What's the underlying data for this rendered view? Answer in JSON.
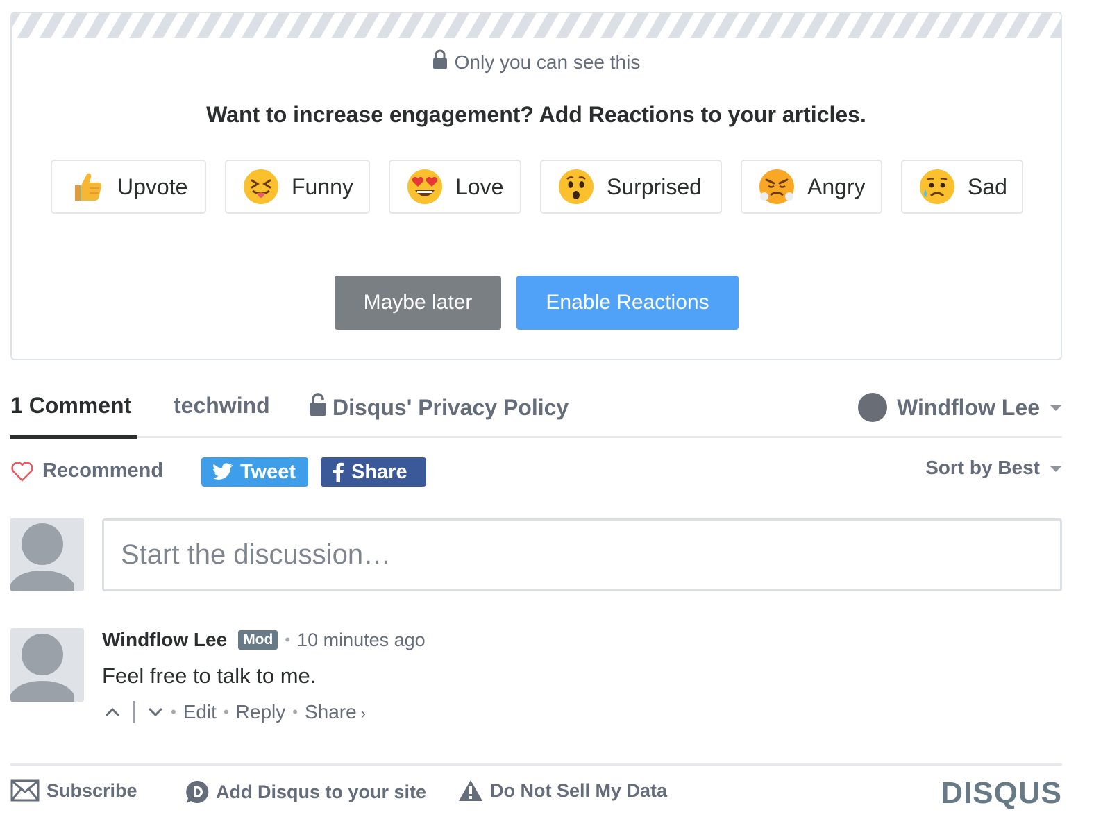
{
  "promo": {
    "private_note": "Only you can see this",
    "title": "Want to increase engagement? Add Reactions to your articles.",
    "reactions": [
      {
        "label": "Upvote",
        "icon": "thumbs-up-emoji"
      },
      {
        "label": "Funny",
        "icon": "funny-face-emoji"
      },
      {
        "label": "Love",
        "icon": "heart-eyes-emoji"
      },
      {
        "label": "Surprised",
        "icon": "surprised-face-emoji"
      },
      {
        "label": "Angry",
        "icon": "angry-face-emoji"
      },
      {
        "label": "Sad",
        "icon": "sad-face-emoji"
      }
    ],
    "maybe_later": "Maybe later",
    "enable": "Enable Reactions"
  },
  "nav": {
    "comments": "1 Comment",
    "forum": "techwind",
    "privacy": "Disqus' Privacy Policy",
    "user": "Windflow Lee"
  },
  "actions": {
    "recommend": "Recommend",
    "tweet": "Tweet",
    "share": "Share",
    "sort": "Sort by Best"
  },
  "compose": {
    "placeholder": "Start the discussion…"
  },
  "comment": {
    "author": "Windflow Lee",
    "badge": "Mod",
    "timestamp": "10 minutes ago",
    "body": "Feel free to talk to me.",
    "edit": "Edit",
    "reply": "Reply",
    "share": "Share"
  },
  "footer": {
    "subscribe": "Subscribe",
    "add": "Add Disqus to your site",
    "do_not_sell": "Do Not Sell My Data",
    "logo": "DISQUS"
  },
  "colors": {
    "accent_blue": "#50a2f8",
    "twitter": "#3f9ee9",
    "facebook": "#3b5998",
    "muted_text": "#656c7a",
    "button_gray": "#7a7f84"
  }
}
